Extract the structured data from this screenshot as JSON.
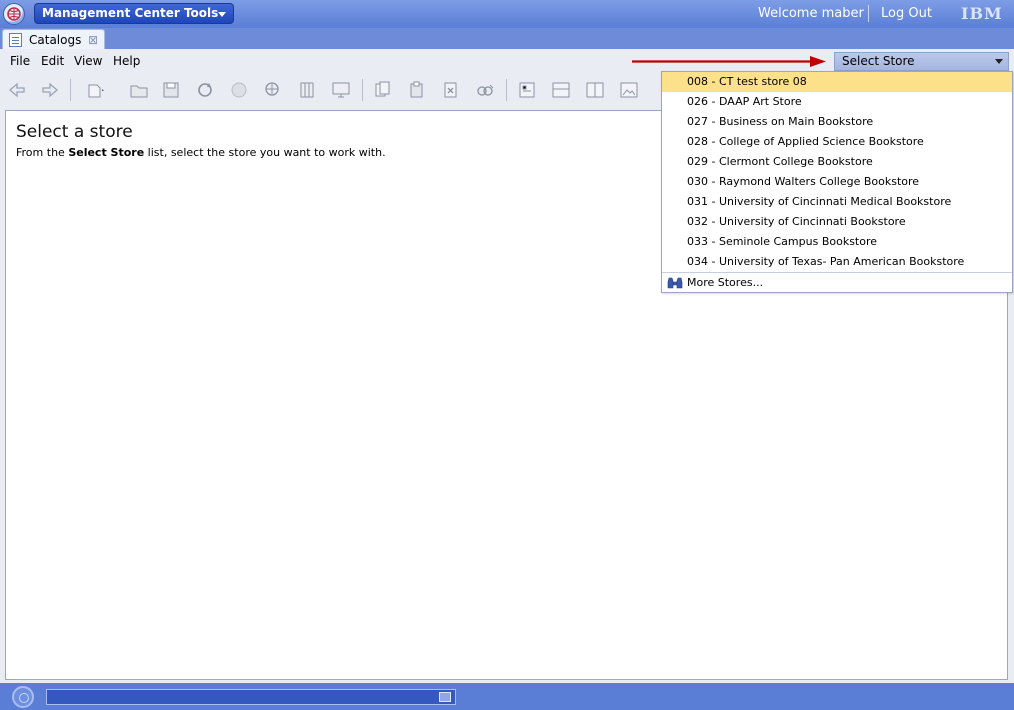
{
  "header": {
    "tools_label": "Management Center Tools",
    "welcome": "Welcome maber",
    "logout": "Log Out",
    "brand": "IBM"
  },
  "tab": {
    "label": "Catalogs"
  },
  "menu": {
    "file": "File",
    "edit": "Edit",
    "view": "View",
    "help": "Help"
  },
  "main": {
    "title": "Select a store",
    "instr_prefix": "From the ",
    "instr_bold": "Select Store",
    "instr_suffix": " list, select the store you want to work with."
  },
  "store_select": {
    "label": "Select Store",
    "selected_index": 0,
    "items": [
      "008 - CT test store 08",
      "026 - DAAP Art Store",
      "027 - Business on Main Bookstore",
      "028 - College of Applied Science Bookstore",
      "029 - Clermont College Bookstore",
      "030 - Raymond Walters College Bookstore",
      "031 - University of Cincinnati Medical Bookstore",
      "032 - University of Cincinnati Bookstore",
      "033 - Seminole Campus Bookstore",
      "034 - University of Texas- Pan American Bookstore"
    ],
    "more": "More Stores..."
  },
  "colors": {
    "selected_highlight": "#fde08a",
    "frame_blue": "#5a7ed6",
    "arrow_red": "#c00000"
  }
}
